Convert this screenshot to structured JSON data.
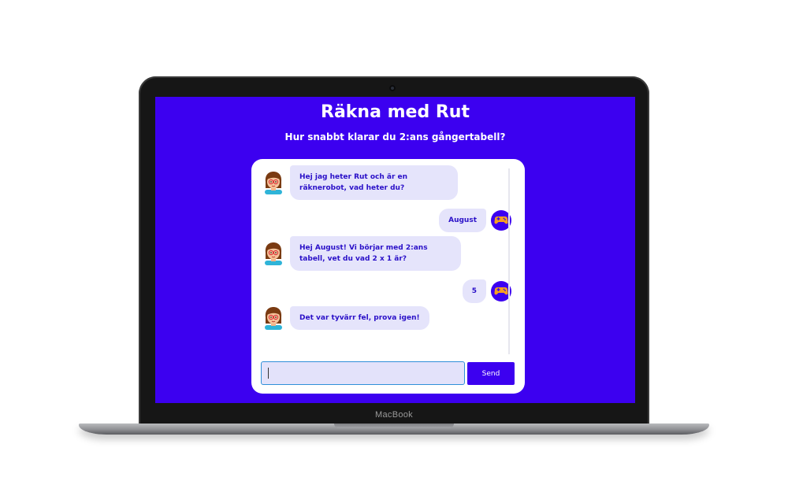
{
  "device": {
    "brand_label": "MacBook"
  },
  "app": {
    "title": "Räkna med Rut",
    "subtitle": "Hur snabbt klarar du 2:ans gångertabell?"
  },
  "chat": {
    "messages": [
      {
        "sender": "bot",
        "text": "Hej jag heter Rut och är en räknerobot, vad heter du?"
      },
      {
        "sender": "user",
        "text": "August"
      },
      {
        "sender": "bot",
        "text": "Hej August! Vi börjar med 2:ans tabell, vet du vad 2 x 1 är?"
      },
      {
        "sender": "user",
        "text": "5"
      },
      {
        "sender": "bot",
        "text": "Det var tyvärr fel, prova igen!"
      }
    ],
    "input": {
      "value": "",
      "placeholder": ""
    },
    "send_label": "Send"
  },
  "icons": {
    "bot_avatar": "robot-girl-avatar-icon",
    "user_avatar": "game-controller-avatar-icon"
  },
  "colors": {
    "accent": "#3c00f0",
    "bubble": "#e5e4fb",
    "bubble_text": "#2a10c8",
    "user_avatar_bg": "#3c00f0",
    "user_avatar_fg": "#f6a020"
  }
}
